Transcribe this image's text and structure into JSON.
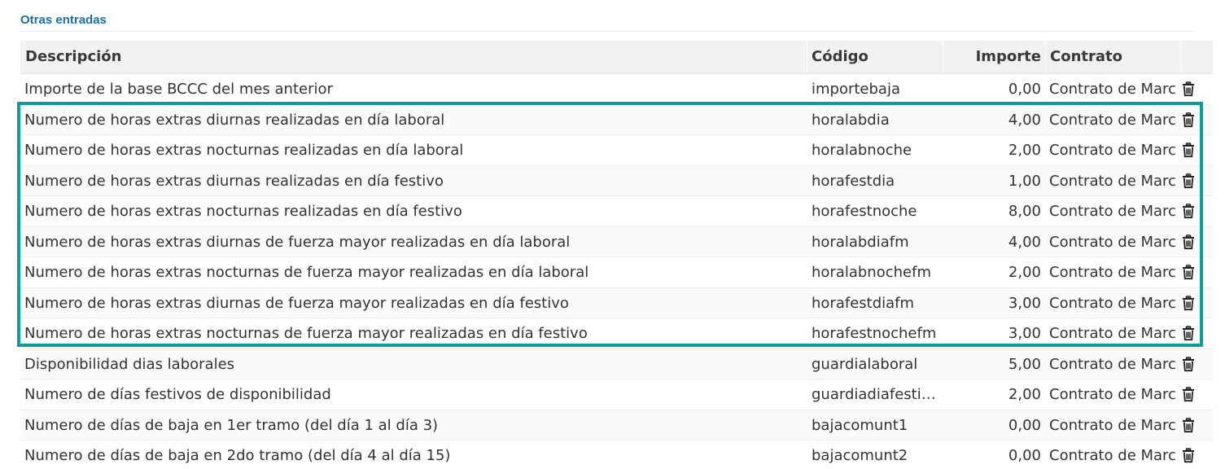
{
  "section": {
    "title": "Otras entradas"
  },
  "table": {
    "headers": {
      "description": "Descripción",
      "code": "Código",
      "amount": "Importe",
      "contract": "Contrato"
    },
    "rows": [
      {
        "description": "Importe de la base BCCC del mes anterior",
        "code": "importebaja",
        "amount": "0,00",
        "contract": "Contrato de Marc"
      },
      {
        "description": "Numero de horas extras diurnas realizadas en día laboral",
        "code": "horalabdia",
        "amount": "4,00",
        "contract": "Contrato de Marc"
      },
      {
        "description": "Numero de horas extras nocturnas realizadas en día laboral",
        "code": "horalabnoche",
        "amount": "2,00",
        "contract": "Contrato de Marc"
      },
      {
        "description": "Numero de horas extras diurnas realizadas en día festivo",
        "code": "horafestdia",
        "amount": "1,00",
        "contract": "Contrato de Marc"
      },
      {
        "description": "Numero de horas extras nocturnas realizadas en día festivo",
        "code": "horafestnoche",
        "amount": "8,00",
        "contract": "Contrato de Marc"
      },
      {
        "description": "Numero de horas extras diurnas de fuerza mayor realizadas en día laboral",
        "code": "horalabdiafm",
        "amount": "4,00",
        "contract": "Contrato de Marc"
      },
      {
        "description": "Numero de horas extras nocturnas de fuerza mayor realizadas en día laboral",
        "code": "horalabnochefm",
        "amount": "2,00",
        "contract": "Contrato de Marc"
      },
      {
        "description": "Numero de horas extras diurnas de fuerza mayor realizadas en día festivo",
        "code": "horafestdiafm",
        "amount": "3,00",
        "contract": "Contrato de Marc"
      },
      {
        "description": "Numero de horas extras nocturnas de fuerza mayor realizadas en día festivo",
        "code": "horafestnochefm",
        "amount": "3,00",
        "contract": "Contrato de Marc"
      },
      {
        "description": "Disponibilidad dias laborales",
        "code": "guardialaboral",
        "amount": "5,00",
        "contract": "Contrato de Marc"
      },
      {
        "description": "Numero de días festivos de disponibilidad",
        "code": "guardiadiafestiv…",
        "amount": "2,00",
        "contract": "Contrato de Marc"
      },
      {
        "description": "Numero de días de baja en 1er tramo (del día 1 al día 3)",
        "code": "bajacomunt1",
        "amount": "0,00",
        "contract": "Contrato de Marc"
      },
      {
        "description": "Numero de días de baja en 2do tramo (del día 4 al día 15)",
        "code": "bajacomunt2",
        "amount": "0,00",
        "contract": "Contrato de Marc"
      }
    ],
    "row_action_icon": "trash-icon"
  },
  "colors": {
    "section_title": "#1b6fa6",
    "highlight_border": "#0e9e9a",
    "header_bg": "#f1f1f1"
  }
}
